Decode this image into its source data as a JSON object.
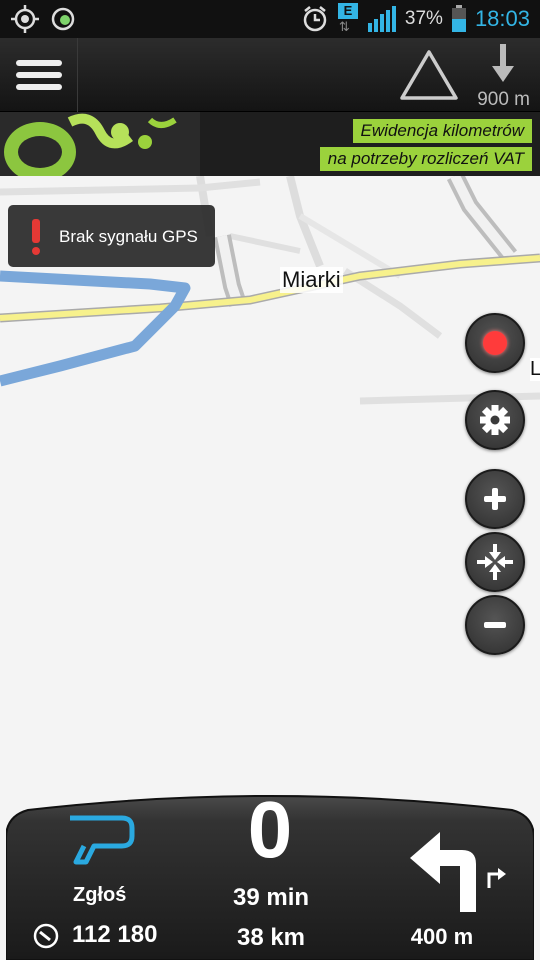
{
  "status_bar": {
    "network_type": "E",
    "battery_percent": "37%",
    "clock": "18:03",
    "accent_color": "#33b5e5"
  },
  "top_bar": {
    "warning_icon": "speed-camera-triangle-icon",
    "distance_to_warning": "900 m"
  },
  "banner": {
    "line1": "Ewidencja kilometrów",
    "line2": "na potrzeby rozliczeń VAT",
    "accent_color": "#9bd23c"
  },
  "map": {
    "place_label": "Miarki",
    "edge_label": "L",
    "gps_toast": "Brak sygnału GPS"
  },
  "map_controls": [
    "record-button",
    "settings-button",
    "zoom-in-button",
    "fit-button",
    "zoom-out-button"
  ],
  "bottom_panel": {
    "report_label": "Zgłoś",
    "odometer": "112 180",
    "speed": "0",
    "eta_time": "39 min",
    "remaining_distance": "38 km",
    "turn_distance": "400 m"
  }
}
